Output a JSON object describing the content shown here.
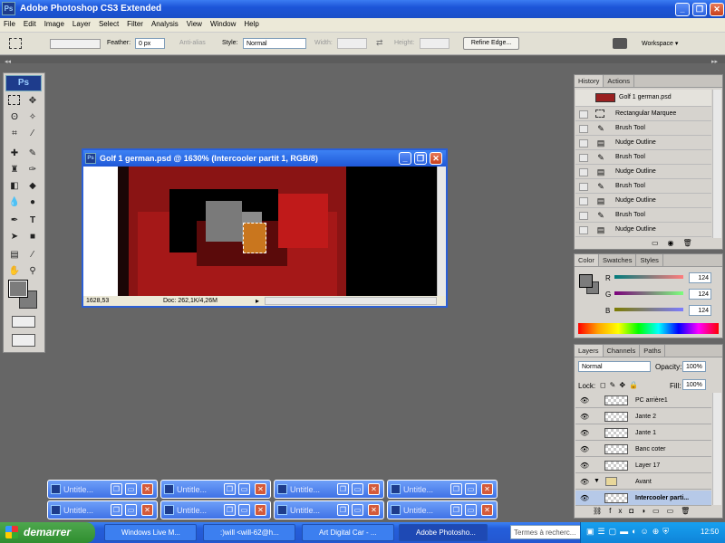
{
  "app": {
    "title": "Adobe Photoshop CS3 Extended",
    "logo": "Ps"
  },
  "menu": [
    "File",
    "Edit",
    "Image",
    "Layer",
    "Select",
    "Filter",
    "Analysis",
    "View",
    "Window",
    "Help"
  ],
  "options": {
    "feather_label": "Feather:",
    "feather_value": "0 px",
    "antialias_label": "Anti-alias",
    "style_label": "Style:",
    "style_value": "Normal",
    "width_label": "Width:",
    "height_label": "Height:",
    "refine_edge": "Refine Edge...",
    "workspace": "Workspace ▾"
  },
  "document": {
    "title": "Golf 1 german.psd @ 1630% (Intercooler partit 1, RGB/8)",
    "zoom": "1628,53",
    "doc_info": "Doc: 262,1K/4,26M"
  },
  "history": {
    "tabs": [
      "History",
      "Actions"
    ],
    "snapshot": "Golf 1 german.psd",
    "items": [
      "Rectangular Marquee",
      "Brush Tool",
      "Nudge Outline",
      "Brush Tool",
      "Nudge Outline",
      "Brush Tool",
      "Nudge Outline",
      "Brush Tool",
      "Nudge Outline"
    ]
  },
  "color": {
    "tabs": [
      "Color",
      "Swatches",
      "Styles"
    ],
    "r_label": "R",
    "g_label": "G",
    "b_label": "B",
    "r": "124",
    "g": "124",
    "b": "124"
  },
  "layers": {
    "tabs": [
      "Layers",
      "Channels",
      "Paths"
    ],
    "blend_mode": "Normal",
    "opacity_label": "Opacity:",
    "opacity": "100%",
    "lock_label": "Lock:",
    "fill_label": "Fill:",
    "fill": "100%",
    "items": [
      "PC arrière1",
      "Jante 2",
      "Jante 1",
      "Banc coter",
      "Layer 17",
      "Avant",
      "Intercooler parti..."
    ]
  },
  "minimized": [
    "Untitle...",
    "Untitle...",
    "Untitle...",
    "Untitle...",
    "Untitle...",
    "Untitle...",
    "Untitle...",
    "Untitle..."
  ],
  "taskbar": {
    "start": "demarrer",
    "tasks": [
      "Windows Live M...",
      ":)will <will-62@h...",
      "Art Digital Car - ...",
      "Adobe Photosho..."
    ],
    "search_placeholder": "Termes à recherc...",
    "clock": "12:50"
  }
}
